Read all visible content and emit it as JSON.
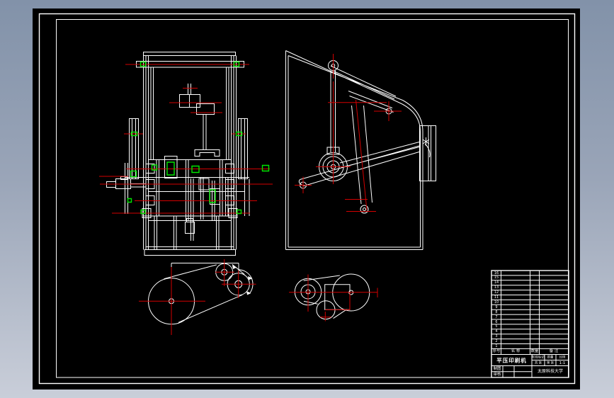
{
  "window": {
    "background_top": "#8292a9",
    "background_bottom": "#c9ced9",
    "canvas_color": "#000000"
  },
  "colors": {
    "line": "#ffffff",
    "centerline_red": "#d40000",
    "highlight_green": "#00e400"
  },
  "drawing": {
    "type": "CAD assembly drawing",
    "views": {
      "front_view": "machine front view with gear shafts",
      "side_view": "machine side view with linkage",
      "belt_drive_left": "belt and pulley transmission diagram",
      "belt_drive_right": "belt and pulley transmission diagram"
    }
  },
  "parts_table": {
    "row_numbers": [
      "16",
      "15",
      "14",
      "13",
      "12",
      "11",
      "10",
      "9",
      "8",
      "7",
      "6",
      "5",
      "4",
      "3",
      "2",
      "1"
    ],
    "header": {
      "no": "序号",
      "name": "名 称",
      "qty": "数量",
      "note": "备 注"
    },
    "title_block": {
      "title": "平压印刷机",
      "stage_label": "阶段标记",
      "mass_label": "质量",
      "scale_label": "比例",
      "scale_value": "1:1",
      "sheet_total": "共 张",
      "sheet_no": "第 张",
      "draw_label": "制图",
      "check_label": "审核",
      "org": "太原科技大学"
    }
  }
}
